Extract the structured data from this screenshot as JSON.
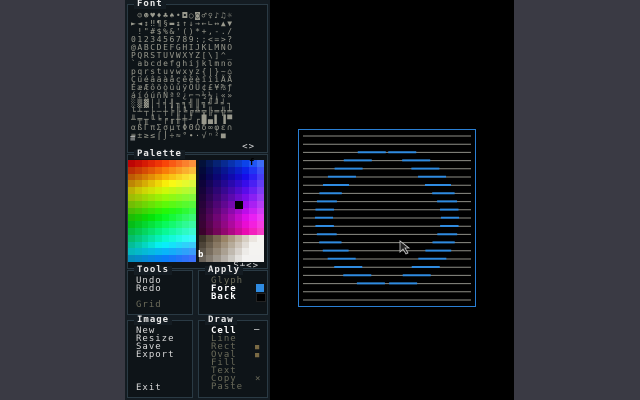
{
  "font_panel": {
    "title": "Font",
    "nav": "<>",
    "glyph_rows": [
      " ☺☻♥♦♣♠•◘○◙♂♀♪♫☼",
      "►◄↕‼¶§▬↨↑↓→←∟↔▲▼",
      " !\"#$%&'()*+,-./",
      "0123456789:;<=>?",
      "@ABCDEFGHIJKLMNO",
      "PQRSTUVWXYZ[\\]^_",
      "`abcdefghijklmno",
      "pqrstuvwxyz{|}~⌂",
      "ÇüéâäàåçêëèïîìÄÅ",
      "ÉæÆôöòûùÿÖÜ¢£¥₧ƒ",
      "áíóúñÑªº¿⌐¬½¼¡«»",
      "░▒▓│┤╡╢╖╕╣║╗╝╜╛┐",
      "└┴┬├─┼╞╟╚╔╩╦╠═╬╧",
      "╨╤╥╙╘╒╓╫╪┘┌█▄▌▐▀",
      "αßΓπΣσµτΦΘΩδ∞φε∩",
      "≡±≥≤⌠⌡÷≈°∙·√ⁿ²■ "
    ]
  },
  "palette_panel": {
    "title": "Palette",
    "fore_marker": "f",
    "back_marker": "b",
    "nav": "S+<>"
  },
  "tools_panel": {
    "title": "Tools",
    "items": [
      {
        "label": "Undo",
        "enabled": true
      },
      {
        "label": "Redo",
        "enabled": true
      },
      {
        "label": "Grid",
        "enabled": false
      }
    ]
  },
  "apply_panel": {
    "title": "Apply",
    "items": [
      {
        "label": "Glyph",
        "enabled": false,
        "swatch": ""
      },
      {
        "label": "Fore",
        "enabled": true,
        "swatch": "#2f8be0"
      },
      {
        "label": "Back",
        "enabled": true,
        "swatch": "#000000"
      }
    ]
  },
  "image_panel": {
    "title": "Image",
    "items": [
      {
        "label": "New"
      },
      {
        "label": "Resize"
      },
      {
        "label": "Save"
      },
      {
        "label": "Export"
      },
      {
        "label": "Exit"
      }
    ]
  },
  "draw_panel": {
    "title": "Draw",
    "items": [
      {
        "label": "Cell",
        "enabled": true,
        "selected": true,
        "marker": "—"
      },
      {
        "label": "Line",
        "enabled": false,
        "marker": ""
      },
      {
        "label": "Rect",
        "enabled": false,
        "marker": "■"
      },
      {
        "label": "Oval",
        "enabled": false,
        "marker": "■"
      },
      {
        "label": "Fill",
        "enabled": false,
        "marker": ""
      },
      {
        "label": "Text",
        "enabled": false,
        "marker": ""
      },
      {
        "label": "Copy",
        "enabled": false,
        "marker": "×"
      },
      {
        "label": "Paste",
        "enabled": false,
        "marker": ""
      }
    ]
  },
  "colors": {
    "accent": "#2f8be0",
    "panel_border": "#2a3a44",
    "text": "#d8d8d8",
    "disabled_text": "#6b6b5a"
  }
}
